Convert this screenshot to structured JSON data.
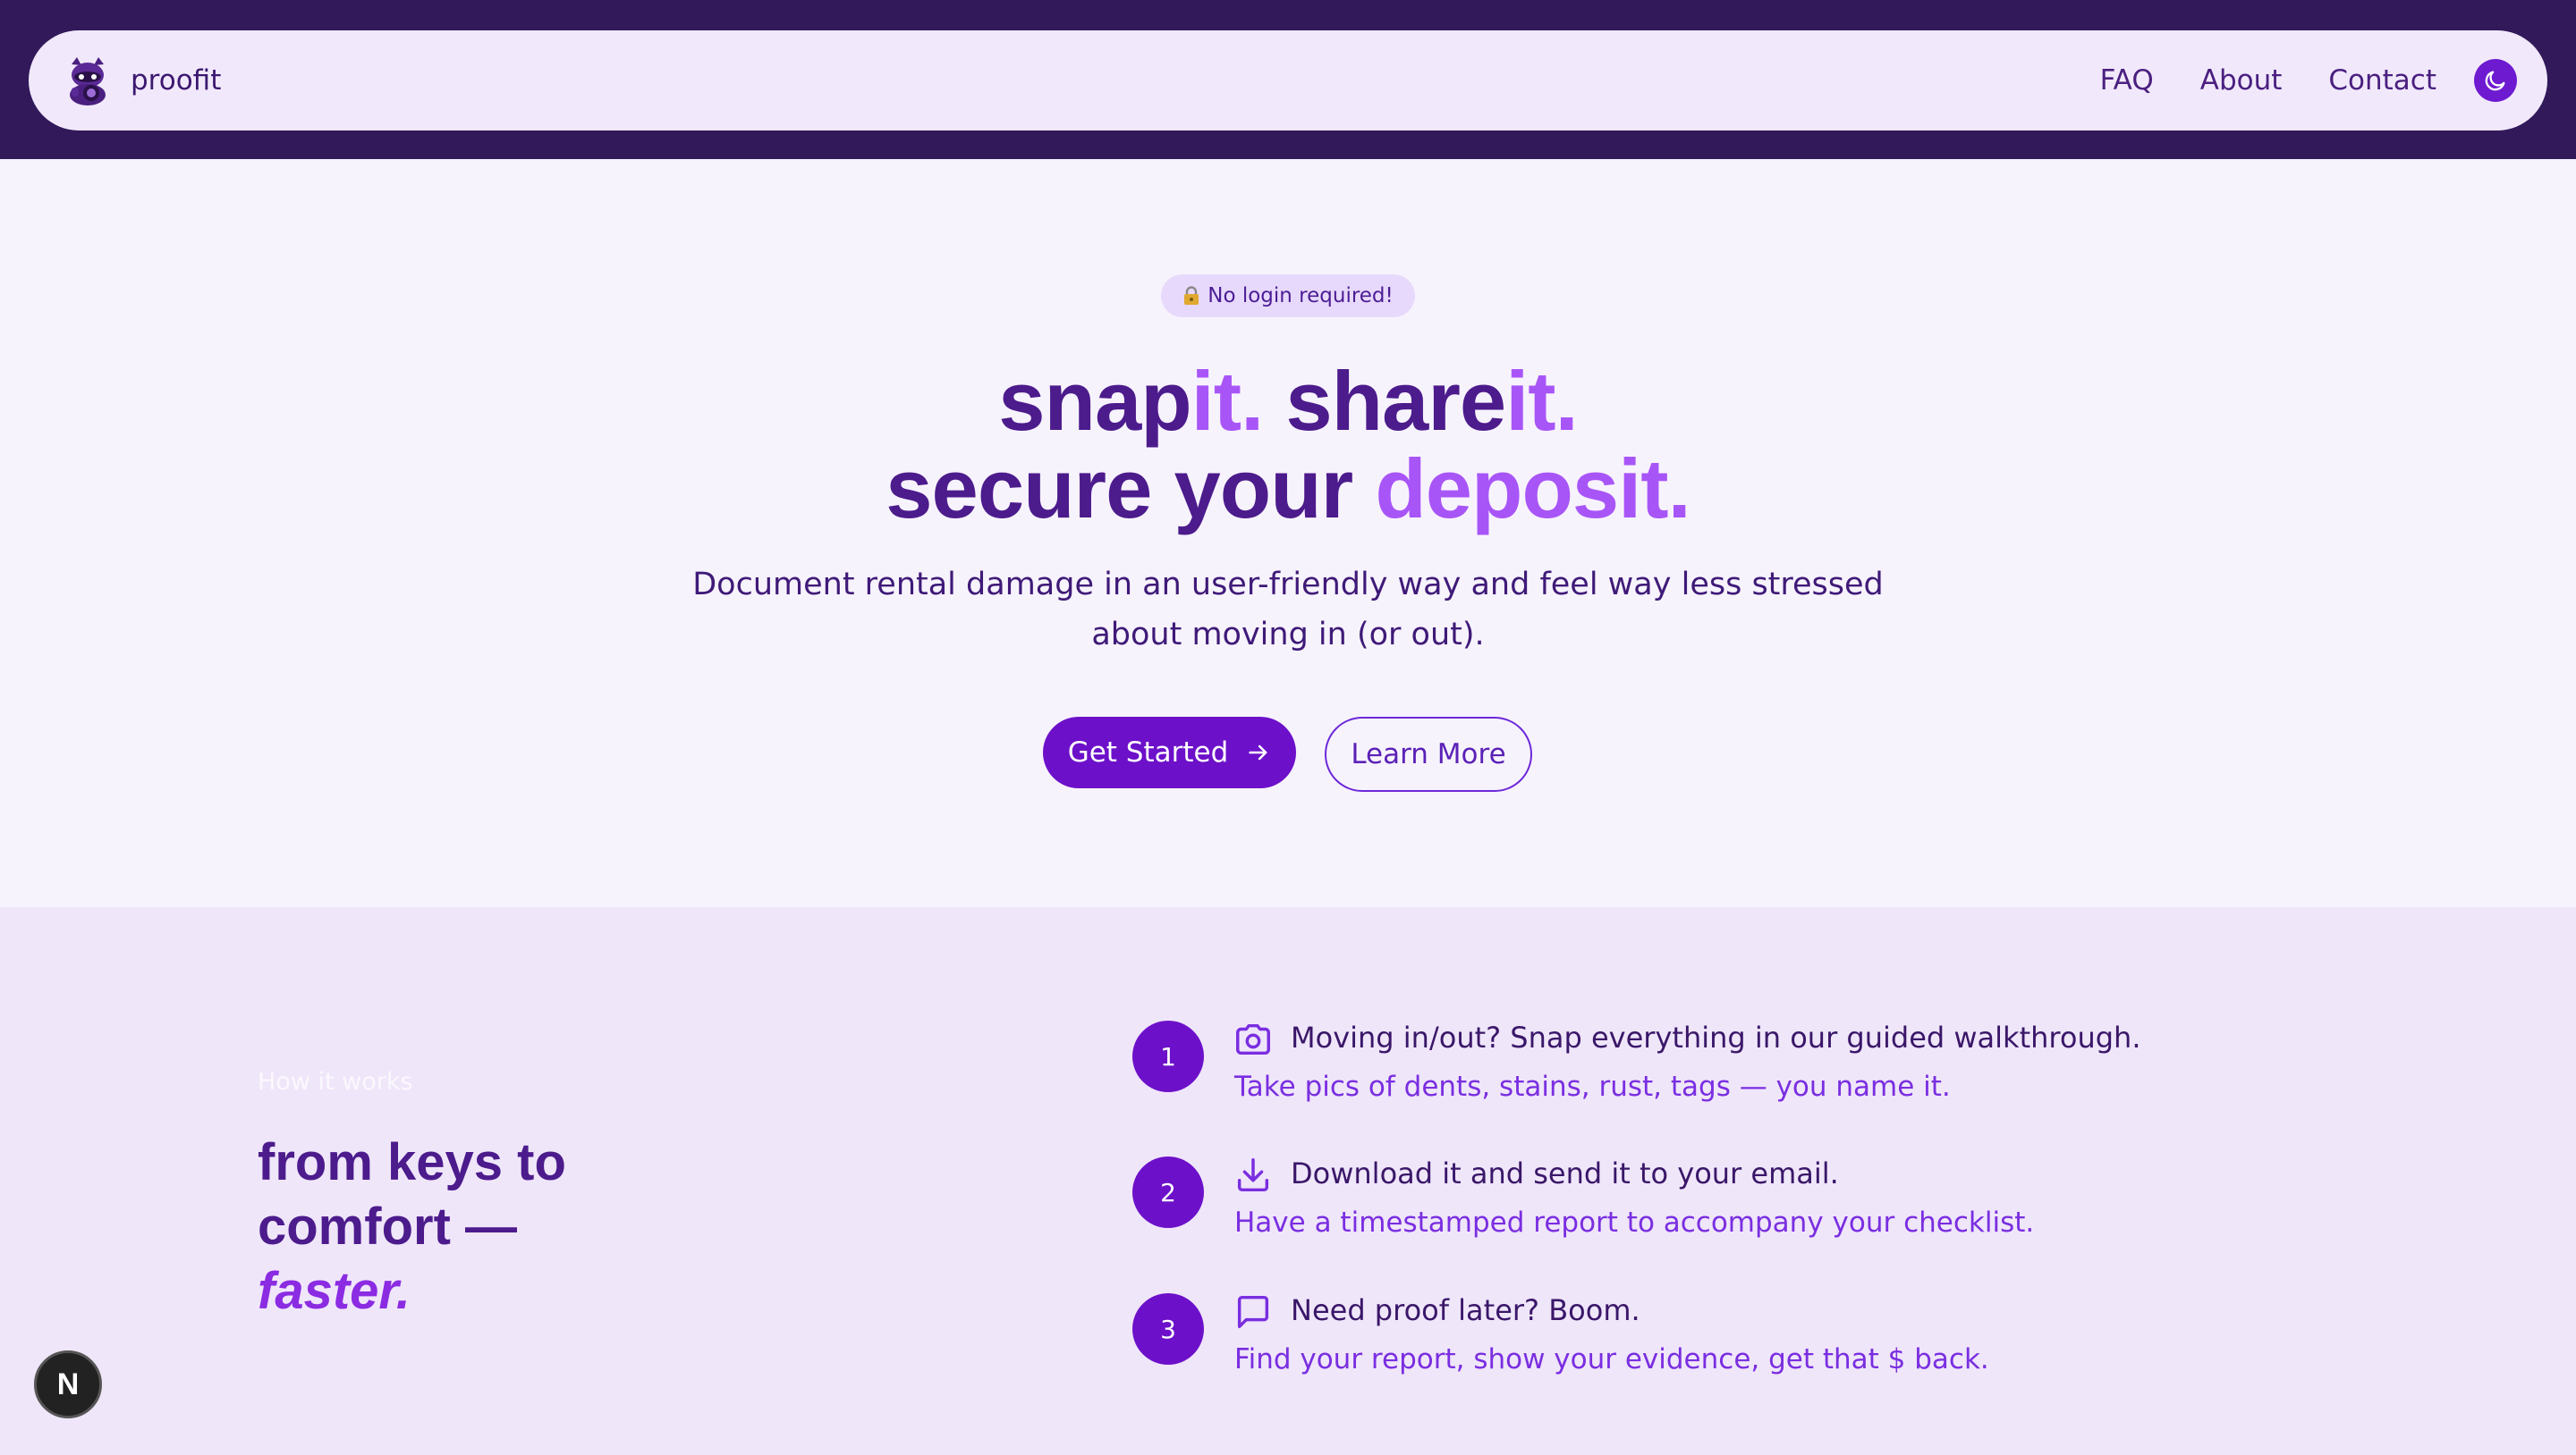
{
  "header": {
    "brand_name": "proofit",
    "nav": [
      {
        "label": "FAQ"
      },
      {
        "label": "About"
      },
      {
        "label": "Contact"
      }
    ]
  },
  "hero": {
    "badge": "No login required!",
    "headline": {
      "line1_part1": "snap",
      "line1_part2": "it.",
      "line1_part3": "share",
      "line1_part4": "it.",
      "line2_part1": "secure your",
      "line2_part2": "deposit."
    },
    "subtitle": "Document rental damage in an user-friendly way and feel way less stressed about moving in (or out).",
    "primary_cta": "Get Started",
    "secondary_cta": "Learn More"
  },
  "how_it_works": {
    "eyebrow": "How it works",
    "title_line1": "from keys to",
    "title_line2": "comfort —",
    "title_accent": "faster.",
    "steps": [
      {
        "number": "1",
        "icon": "camera-icon",
        "title": "Moving in/out? Snap everything in our guided walkthrough.",
        "description": "Take pics of dents, stains, rust, tags — you name it."
      },
      {
        "number": "2",
        "icon": "download-icon",
        "title": "Download it and send it to your email.",
        "description": "Have a timestamped report to accompany your checklist."
      },
      {
        "number": "3",
        "icon": "message-icon",
        "title": "Need proof later? Boom.",
        "description": "Find your report, show your evidence, get that $ back."
      }
    ]
  },
  "dev_badge": "N",
  "colors": {
    "top_band": "#32195a",
    "navbar_bg": "#f1e9fb",
    "primary": "#6d10c9",
    "accent": "#a855f7",
    "heading": "#4c1b8c",
    "section_bg": "#efe6fa"
  }
}
